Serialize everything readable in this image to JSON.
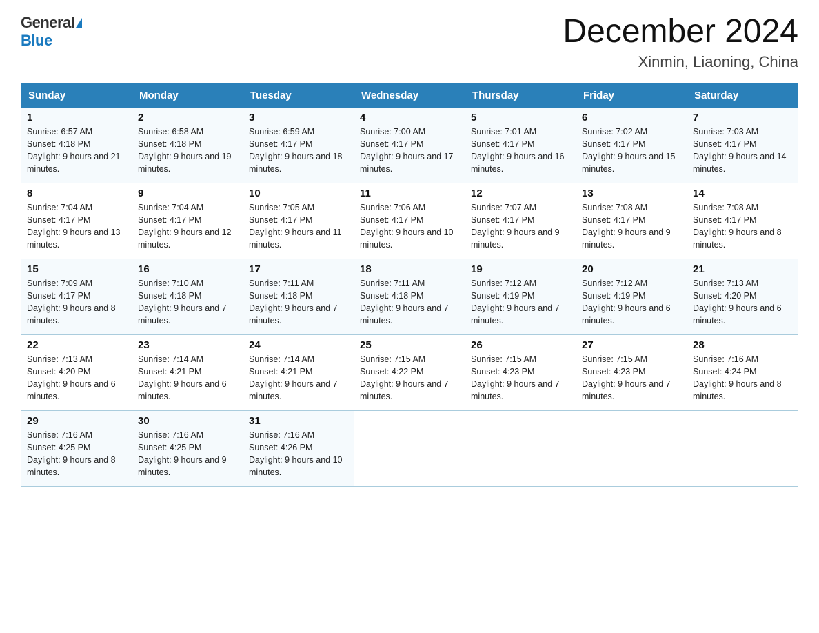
{
  "header": {
    "logo_general": "General",
    "logo_blue": "Blue",
    "month_title": "December 2024",
    "location": "Xinmin, Liaoning, China"
  },
  "days_of_week": [
    "Sunday",
    "Monday",
    "Tuesday",
    "Wednesday",
    "Thursday",
    "Friday",
    "Saturday"
  ],
  "weeks": [
    [
      {
        "day": "1",
        "sunrise": "6:57 AM",
        "sunset": "4:18 PM",
        "daylight": "9 hours and 21 minutes."
      },
      {
        "day": "2",
        "sunrise": "6:58 AM",
        "sunset": "4:18 PM",
        "daylight": "9 hours and 19 minutes."
      },
      {
        "day": "3",
        "sunrise": "6:59 AM",
        "sunset": "4:17 PM",
        "daylight": "9 hours and 18 minutes."
      },
      {
        "day": "4",
        "sunrise": "7:00 AM",
        "sunset": "4:17 PM",
        "daylight": "9 hours and 17 minutes."
      },
      {
        "day": "5",
        "sunrise": "7:01 AM",
        "sunset": "4:17 PM",
        "daylight": "9 hours and 16 minutes."
      },
      {
        "day": "6",
        "sunrise": "7:02 AM",
        "sunset": "4:17 PM",
        "daylight": "9 hours and 15 minutes."
      },
      {
        "day": "7",
        "sunrise": "7:03 AM",
        "sunset": "4:17 PM",
        "daylight": "9 hours and 14 minutes."
      }
    ],
    [
      {
        "day": "8",
        "sunrise": "7:04 AM",
        "sunset": "4:17 PM",
        "daylight": "9 hours and 13 minutes."
      },
      {
        "day": "9",
        "sunrise": "7:04 AM",
        "sunset": "4:17 PM",
        "daylight": "9 hours and 12 minutes."
      },
      {
        "day": "10",
        "sunrise": "7:05 AM",
        "sunset": "4:17 PM",
        "daylight": "9 hours and 11 minutes."
      },
      {
        "day": "11",
        "sunrise": "7:06 AM",
        "sunset": "4:17 PM",
        "daylight": "9 hours and 10 minutes."
      },
      {
        "day": "12",
        "sunrise": "7:07 AM",
        "sunset": "4:17 PM",
        "daylight": "9 hours and 9 minutes."
      },
      {
        "day": "13",
        "sunrise": "7:08 AM",
        "sunset": "4:17 PM",
        "daylight": "9 hours and 9 minutes."
      },
      {
        "day": "14",
        "sunrise": "7:08 AM",
        "sunset": "4:17 PM",
        "daylight": "9 hours and 8 minutes."
      }
    ],
    [
      {
        "day": "15",
        "sunrise": "7:09 AM",
        "sunset": "4:17 PM",
        "daylight": "9 hours and 8 minutes."
      },
      {
        "day": "16",
        "sunrise": "7:10 AM",
        "sunset": "4:18 PM",
        "daylight": "9 hours and 7 minutes."
      },
      {
        "day": "17",
        "sunrise": "7:11 AM",
        "sunset": "4:18 PM",
        "daylight": "9 hours and 7 minutes."
      },
      {
        "day": "18",
        "sunrise": "7:11 AM",
        "sunset": "4:18 PM",
        "daylight": "9 hours and 7 minutes."
      },
      {
        "day": "19",
        "sunrise": "7:12 AM",
        "sunset": "4:19 PM",
        "daylight": "9 hours and 7 minutes."
      },
      {
        "day": "20",
        "sunrise": "7:12 AM",
        "sunset": "4:19 PM",
        "daylight": "9 hours and 6 minutes."
      },
      {
        "day": "21",
        "sunrise": "7:13 AM",
        "sunset": "4:20 PM",
        "daylight": "9 hours and 6 minutes."
      }
    ],
    [
      {
        "day": "22",
        "sunrise": "7:13 AM",
        "sunset": "4:20 PM",
        "daylight": "9 hours and 6 minutes."
      },
      {
        "day": "23",
        "sunrise": "7:14 AM",
        "sunset": "4:21 PM",
        "daylight": "9 hours and 6 minutes."
      },
      {
        "day": "24",
        "sunrise": "7:14 AM",
        "sunset": "4:21 PM",
        "daylight": "9 hours and 7 minutes."
      },
      {
        "day": "25",
        "sunrise": "7:15 AM",
        "sunset": "4:22 PM",
        "daylight": "9 hours and 7 minutes."
      },
      {
        "day": "26",
        "sunrise": "7:15 AM",
        "sunset": "4:23 PM",
        "daylight": "9 hours and 7 minutes."
      },
      {
        "day": "27",
        "sunrise": "7:15 AM",
        "sunset": "4:23 PM",
        "daylight": "9 hours and 7 minutes."
      },
      {
        "day": "28",
        "sunrise": "7:16 AM",
        "sunset": "4:24 PM",
        "daylight": "9 hours and 8 minutes."
      }
    ],
    [
      {
        "day": "29",
        "sunrise": "7:16 AM",
        "sunset": "4:25 PM",
        "daylight": "9 hours and 8 minutes."
      },
      {
        "day": "30",
        "sunrise": "7:16 AM",
        "sunset": "4:25 PM",
        "daylight": "9 hours and 9 minutes."
      },
      {
        "day": "31",
        "sunrise": "7:16 AM",
        "sunset": "4:26 PM",
        "daylight": "9 hours and 10 minutes."
      },
      null,
      null,
      null,
      null
    ]
  ]
}
